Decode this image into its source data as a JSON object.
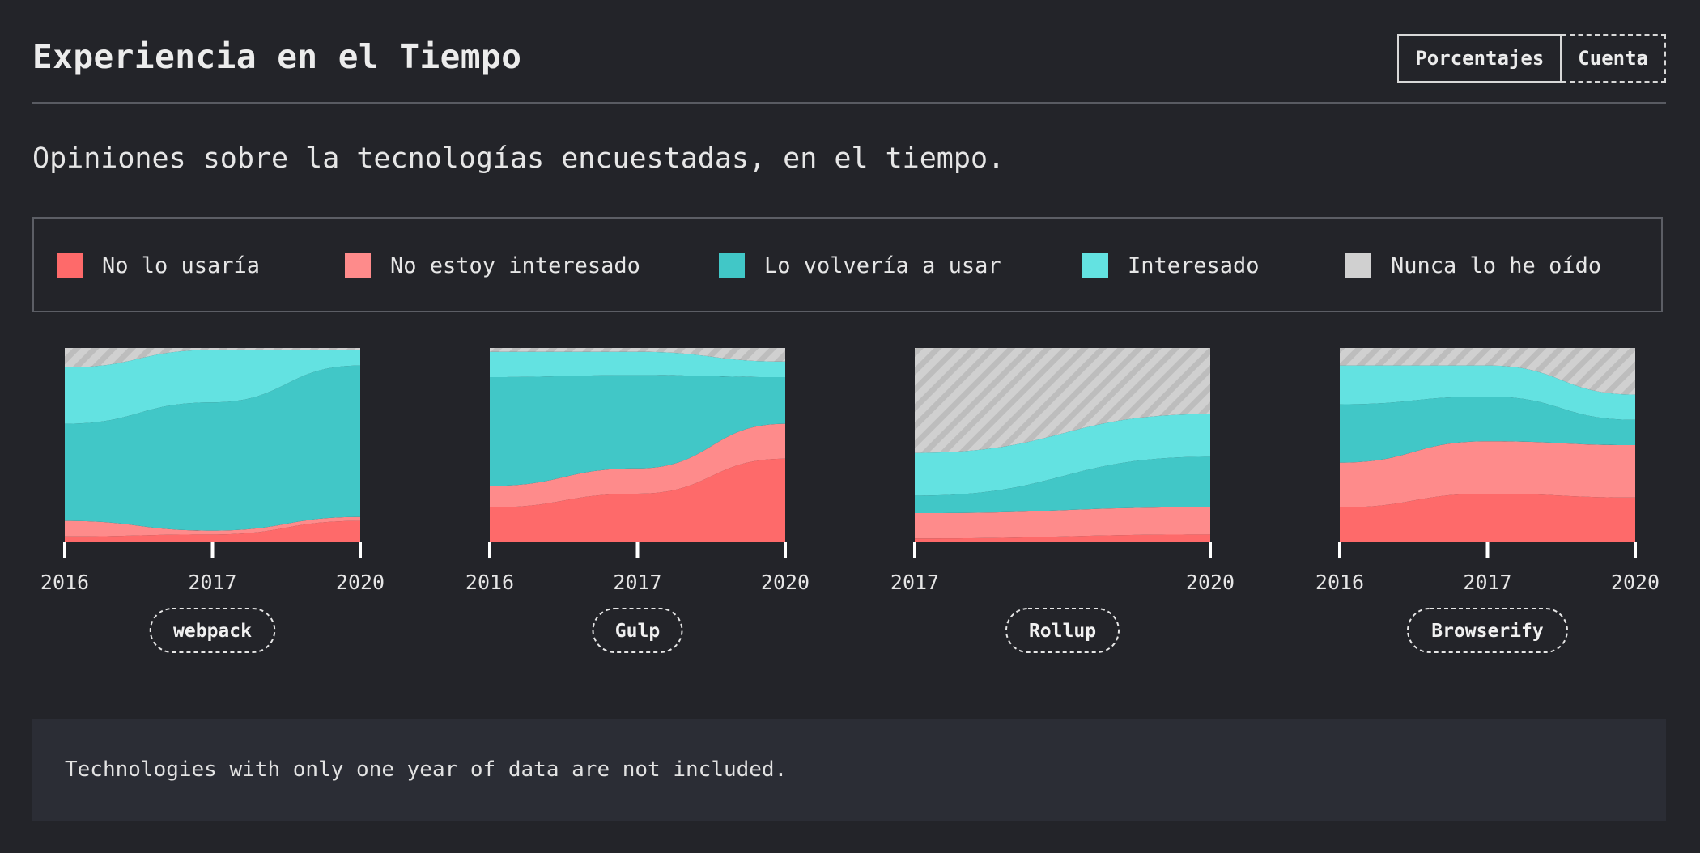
{
  "header": {
    "title": "Experiencia en el Tiempo",
    "toggle": {
      "percentages_label": "Porcentajes",
      "count_label": "Cuenta",
      "active": "percentages"
    }
  },
  "subtitle": "Opiniones sobre la tecnologías encuestadas, en el tiempo.",
  "legend": {
    "items": [
      {
        "key": "would_not_use",
        "label": "No lo usaría",
        "color": "#fe6a6a"
      },
      {
        "key": "not_interested",
        "label": "No estoy interesado",
        "color": "#fe8b8b"
      },
      {
        "key": "would_use",
        "label": "Lo volvería a usar",
        "color": "#41c7c7"
      },
      {
        "key": "interested",
        "label": "Interesado",
        "color": "#63e2e1"
      },
      {
        "key": "never_heard",
        "label": "Nunca lo he oído",
        "color": "#d0d0d0"
      }
    ]
  },
  "chart_data": [
    {
      "type": "area",
      "name": "webpack",
      "x": [
        "2016",
        "2017",
        "2020"
      ],
      "ylim": [
        0,
        100
      ],
      "series": [
        {
          "name": "No lo usaría",
          "values": [
            3,
            4,
            11
          ]
        },
        {
          "name": "No estoy interesado",
          "values": [
            8,
            2,
            2
          ]
        },
        {
          "name": "Lo volvería a usar",
          "values": [
            50,
            66,
            78
          ]
        },
        {
          "name": "Interesado",
          "values": [
            29,
            27,
            8
          ]
        },
        {
          "name": "Nunca lo he oído",
          "values": [
            10,
            1,
            1
          ]
        }
      ]
    },
    {
      "type": "area",
      "name": "Gulp",
      "x": [
        "2016",
        "2017",
        "2020"
      ],
      "ylim": [
        0,
        100
      ],
      "series": [
        {
          "name": "No lo usaría",
          "values": [
            18,
            25,
            43
          ]
        },
        {
          "name": "No estoy interesado",
          "values": [
            11,
            13,
            18
          ]
        },
        {
          "name": "Lo volvería a usar",
          "values": [
            56,
            48,
            24
          ]
        },
        {
          "name": "Interesado",
          "values": [
            13,
            12,
            8
          ]
        },
        {
          "name": "Nunca lo he oído",
          "values": [
            2,
            2,
            7
          ]
        }
      ]
    },
    {
      "type": "area",
      "name": "Rollup",
      "x": [
        "2017",
        "2020"
      ],
      "ylim": [
        0,
        100
      ],
      "series": [
        {
          "name": "No lo usaría",
          "values": [
            2,
            4
          ]
        },
        {
          "name": "No estoy interesado",
          "values": [
            13,
            14
          ]
        },
        {
          "name": "Lo volvería a usar",
          "values": [
            9,
            26
          ]
        },
        {
          "name": "Interesado",
          "values": [
            22,
            22
          ]
        },
        {
          "name": "Nunca lo he oído",
          "values": [
            54,
            34
          ]
        }
      ]
    },
    {
      "type": "area",
      "name": "Browserify",
      "x": [
        "2016",
        "2017",
        "2020"
      ],
      "ylim": [
        0,
        100
      ],
      "series": [
        {
          "name": "No lo usaría",
          "values": [
            18,
            25,
            23
          ]
        },
        {
          "name": "No estoy interesado",
          "values": [
            23,
            27,
            27
          ]
        },
        {
          "name": "Lo volvería a usar",
          "values": [
            30,
            23,
            13
          ]
        },
        {
          "name": "Interesado",
          "values": [
            20,
            16,
            13
          ]
        },
        {
          "name": "Nunca lo he oído",
          "values": [
            9,
            9,
            24
          ]
        }
      ]
    }
  ],
  "footnote": "Technologies with only one year of data are not included."
}
